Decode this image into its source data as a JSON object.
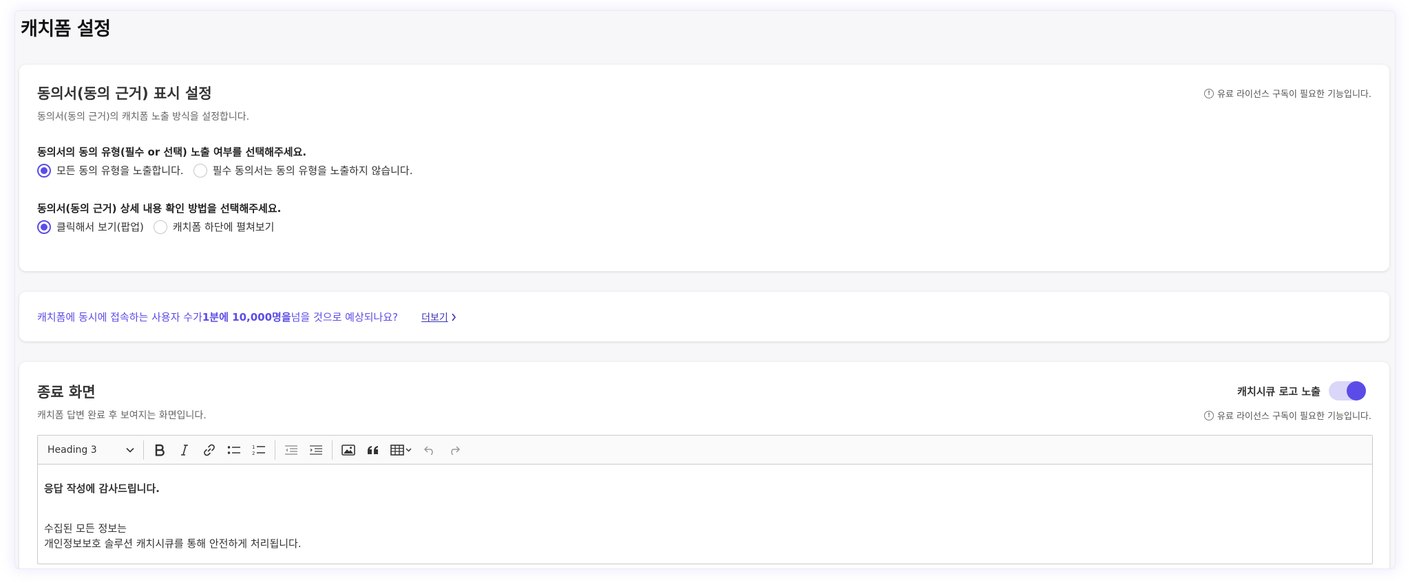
{
  "page": {
    "title": "캐치폼 설정"
  },
  "consent_display": {
    "title": "동의서(동의 근거) 표시 설정",
    "description": "동의서(동의 근거)의 캐치폼 노출 방식을 설정합니다.",
    "license_notice": "유료 라이선스 구독이 필요한 기능입니다.",
    "question1": {
      "label": "동의서의 동의 유형(필수 or 선택) 노출 여부를 선택해주세요.",
      "options": [
        "모든 동의 유형을 노출합니다.",
        "필수 동의서는 동의 유형을 노출하지 않습니다."
      ],
      "selected": 0
    },
    "question2": {
      "label": "동의서(동의 근거) 상세 내용 확인 방법을 선택해주세요.",
      "options": [
        "클릭해서 보기(팝업)",
        "캐치폼 하단에 펼쳐보기"
      ],
      "selected": 0
    }
  },
  "banner": {
    "text_before": "캐치폼에 동시에 접속하는 사용자 수가 ",
    "text_bold": "1분에 10,000명을",
    "text_after": " 넘을 것으로 예상되나요?",
    "link_label": "더보기"
  },
  "end_screen": {
    "title": "종료 화면",
    "description": "캐치폼 답변 완료 후 보여지는 화면입니다.",
    "license_notice": "유료 라이선스 구독이 필요한 기능입니다.",
    "logo_toggle_label": "캐치시큐 로고 노출",
    "logo_toggle_on": true,
    "editor": {
      "heading_select": "Heading 3",
      "content_bold": "응답 작성에 감사드립니다.",
      "content_line1": "수집된 모든 정보는",
      "content_line2": "개인정보보호 솔루션 캐치시큐를 통해 안전하게 처리됩니다."
    }
  },
  "colors": {
    "accent": "#5b4ce8",
    "toggle_track": "#d9d6f7"
  }
}
